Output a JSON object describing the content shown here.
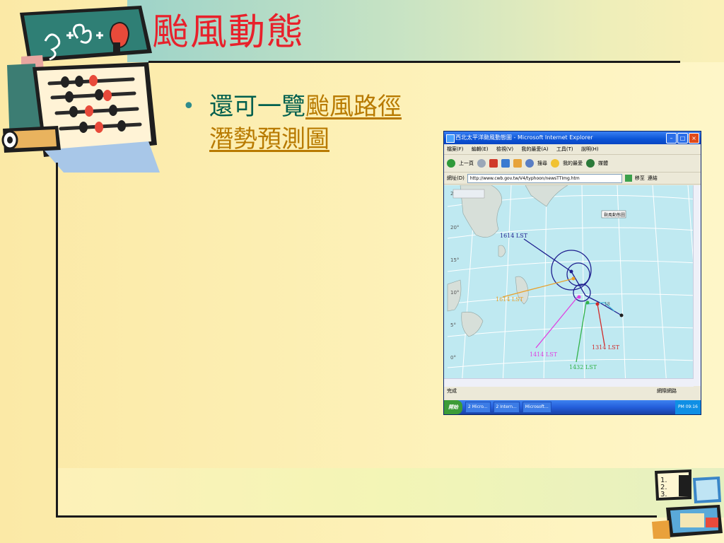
{
  "slide": {
    "title": "颱風動態",
    "bullet_prefix": "還可一覽",
    "bullet_link": "颱風路徑潛勢預測圖"
  },
  "browser": {
    "window_title": "西北太平洋颱風動態圖 - Microsoft Internet Explorer",
    "menu": [
      "檔案(F)",
      "編輯(E)",
      "檢視(V)",
      "我的最愛(A)",
      "工具(T)",
      "說明(H)"
    ],
    "toolbar": [
      "上一頁",
      "搜尋",
      "我的最愛",
      "媒體"
    ],
    "address_label": "網址(D)",
    "address_value": "http://www.cwb.gov.tw/V4/typhoon/newsTTImg.htm",
    "go_label": "移至",
    "links_label": "連結",
    "status_left": "完成",
    "status_right": "網際網路",
    "start_label": "開始",
    "taskbar_items": [
      "2 Micro...",
      "2 Intern...",
      "Microsoft..."
    ],
    "clock": "PM 09:16"
  },
  "map": {
    "lat_labels": [
      "25°",
      "20°",
      "15°",
      "10°",
      "5°",
      "0°"
    ],
    "map_title_box": "颱風動態圖",
    "track_labels": {
      "a": "1614 LST",
      "b": "1614 LST",
      "c": "1414 LST",
      "d": "1314 LST",
      "e": "1432 LST",
      "f": "18"
    },
    "colors": {
      "track_main": "#1f1f8f",
      "track_orange": "#e9a12b",
      "track_magenta": "#e040e0",
      "track_green": "#33b24a",
      "track_red": "#d12a2a",
      "land": "#d7dfd9",
      "sea": "#bfe9f1"
    }
  },
  "colors": {
    "title": "#e8212b",
    "bullet_text": "#005f4e",
    "link": "#b87a00"
  }
}
